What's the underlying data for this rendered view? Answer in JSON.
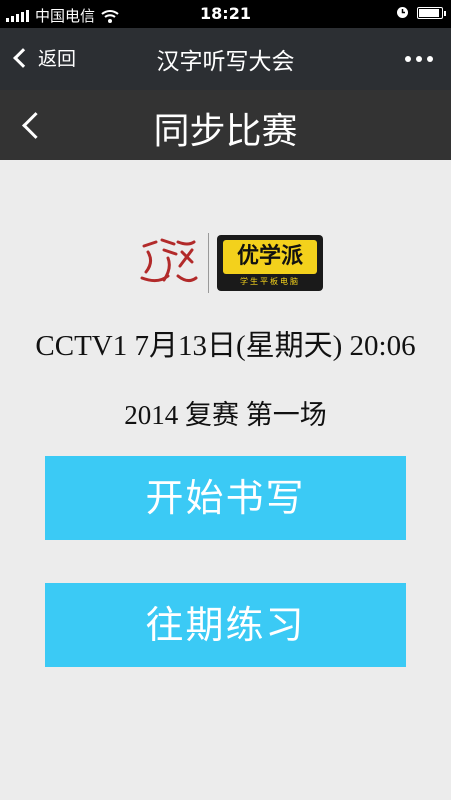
{
  "status_bar": {
    "carrier": "中国电信",
    "time": "18:21"
  },
  "wechat_bar": {
    "back_label": "返回",
    "title": "汉字听写大会"
  },
  "page_header": {
    "title": "同步比赛"
  },
  "logos": {
    "partner_name": "优学派",
    "partner_tagline": "学生平板电脑"
  },
  "match": {
    "schedule": "CCTV1 7月13日(星期天) 20:06",
    "round": "2014 复赛 第一场"
  },
  "actions": {
    "start_label": "开始书写",
    "past_label": "往期练习"
  },
  "colors": {
    "button_bg": "#3bcaf5",
    "header_bg": "#333333",
    "logo_red": "#b22a2a",
    "logo_yellow": "#f3d11c"
  },
  "battery_level": 0.9
}
